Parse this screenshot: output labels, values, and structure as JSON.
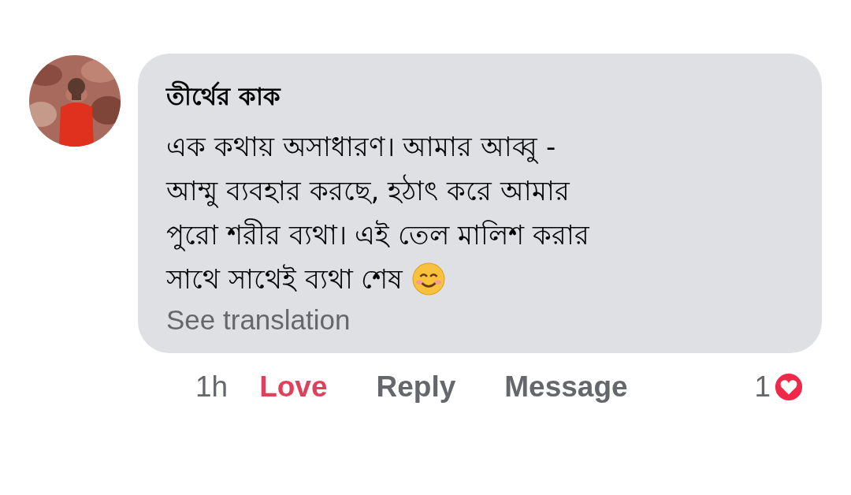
{
  "comment": {
    "author": "তীর্থের কাক",
    "text_lines": [
      "এক কথায় অসাধারণ। আমার আব্বু -",
      "আম্মু ব্যবহার করছে, হঠাৎ করে আমার",
      "পুরো শরীর ব্যথা। এই তেল মালিশ করার",
      "সাথে সাথেই ব্যথা শেষ"
    ],
    "see_translation": "See translation"
  },
  "footer": {
    "time": "1h",
    "reaction": {
      "label": "Love",
      "active": true
    },
    "reply": "Reply",
    "message": "Message",
    "reaction_count": "1"
  }
}
